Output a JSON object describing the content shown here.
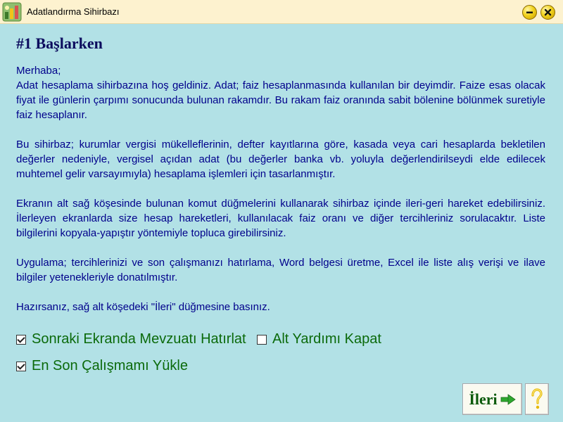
{
  "window": {
    "title": "Adatlandırma Sihirbazı",
    "icon": "app-wizard-icon",
    "controls": [
      "minimize-icon",
      "close-icon"
    ]
  },
  "page": {
    "heading": "#1 Başlarken",
    "greeting": "Merhaba;",
    "paragraphs": [
      "Adat hesaplama sihirbazına hoş geldiniz. Adat; faiz hesaplanmasında kullanılan bir deyimdir. Faize esas olacak fiyat ile günlerin çarpımı sonucunda bulunan rakamdır. Bu rakam faiz oranında sabit bölenine bölünmek suretiyle faiz hesaplanır.",
      "Bu sihirbaz; kurumlar vergisi mükelleflerinin, defter kayıtlarına göre, kasada veya cari hesaplarda bekletilen değerler nedeniyle, vergisel açıdan adat (bu değerler banka vb. yoluyla değerlendirilseydi elde edilecek muhtemel gelir varsayımıyla) hesaplama işlemleri için tasarlanmıştır.",
      "Ekranın alt sağ köşesinde bulunan komut düğmelerini kullanarak sihirbaz içinde ileri-geri hareket edebilirsiniz. İlerleyen ekranlarda size hesap hareketleri, kullanılacak faiz oranı ve diğer tercihleriniz sorulacaktır. Liste bilgilerini kopyala-yapıştır yöntemiyle topluca girebilirsiniz.",
      "Uygulama; tercihlerinizi ve son çalışmanızı hatırlama, Word belgesi üretme, Excel ile liste alış verişi ve ilave bilgiler yetenekleriyle donatılmıştır.",
      "Hazırsanız, sağ alt köşedeki \"İleri\" düğmesine basınız."
    ]
  },
  "options": [
    {
      "label": "Sonraki Ekranda Mevzuatı Hatırlat",
      "checked": true
    },
    {
      "label": "Alt Yardımı Kapat",
      "checked": false
    },
    {
      "label": "En Son Çalışmamı Yükle",
      "checked": true
    }
  ],
  "buttons": {
    "next_label": "İleri",
    "next_icon": "arrow-right-icon",
    "help_icon": "question-mark-icon"
  },
  "colors": {
    "background": "#b2e1e6",
    "title_bar": "#fdf2cf",
    "text": "#00008b",
    "option_text": "#0b6a0b",
    "accent_green": "#2ea82e"
  }
}
